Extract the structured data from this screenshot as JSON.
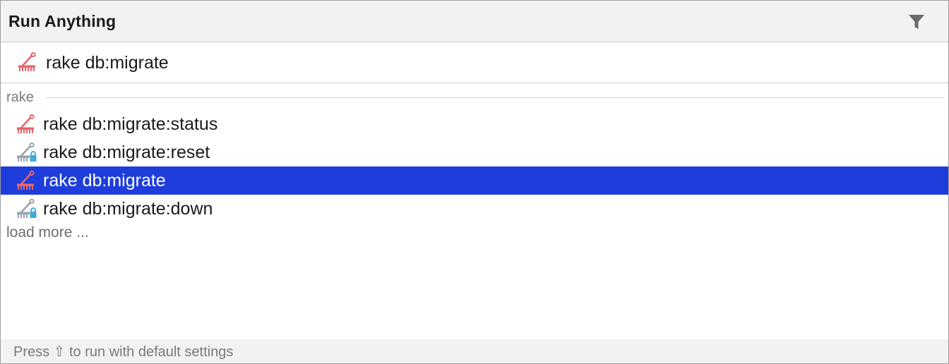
{
  "popup": {
    "title": "Run Anything",
    "filter_icon": "filter-funnel-icon"
  },
  "search": {
    "value": "rake db:migrate",
    "icon": "rake-icon"
  },
  "group": {
    "label": "rake"
  },
  "items": [
    {
      "label": "rake db:migrate:status",
      "icon": "rake-icon",
      "selected": false
    },
    {
      "label": "rake db:migrate:reset",
      "icon": "rake-locked-icon",
      "selected": false
    },
    {
      "label": "rake db:migrate",
      "icon": "rake-icon",
      "selected": true
    },
    {
      "label": "rake db:migrate:down",
      "icon": "rake-locked-icon",
      "selected": false
    }
  ],
  "load_more": "load more ...",
  "footer": {
    "hint": "Press ⇧ to run with default settings"
  },
  "colors": {
    "selection": "#1e3ddb",
    "rake_icon": "#e8666a",
    "rake_locked_icon": "#9aa3ad",
    "lock_badge": "#3fa9d8"
  }
}
